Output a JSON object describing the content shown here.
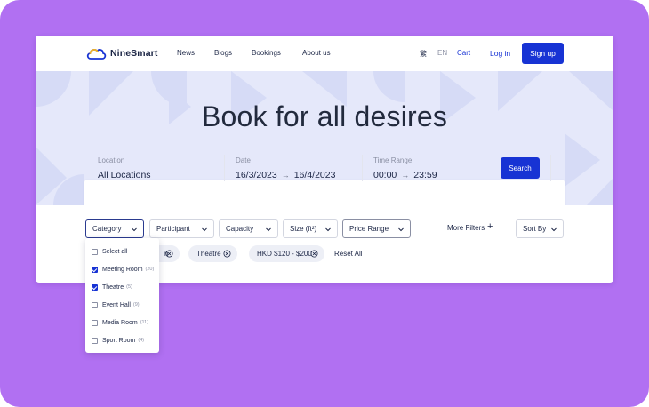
{
  "brand": {
    "name": "NineSmart"
  },
  "nav": {
    "items": [
      "News",
      "Blogs",
      "Bookings",
      "About us"
    ]
  },
  "header": {
    "lang_tc": "繁",
    "lang_en": "EN",
    "cart": "Cart",
    "login": "Log in",
    "signup": "Sign up"
  },
  "hero": {
    "title": "Book for all desires"
  },
  "search": {
    "location_label": "Location",
    "location_value": "All Locations",
    "date_label": "Date",
    "date_start": "16/3/2023",
    "date_end": "16/4/2023",
    "time_label": "Time Range",
    "time_start": "00:00",
    "time_end": "23:59",
    "arrow": "→",
    "button": "Search"
  },
  "filters": {
    "category": "Category",
    "participant": "Participant",
    "capacity": "Capacity",
    "size": "Size (ft²)",
    "price": "Price Range",
    "more": "More Filters",
    "more_icon": "+",
    "sort": "Sort By"
  },
  "chips": {
    "first_partial": "n",
    "theatre": "Theatre",
    "price": "HKD $120 - $200",
    "reset": "Reset All"
  },
  "dropdown": {
    "items": [
      {
        "label": "Select all",
        "count": "",
        "checked": false
      },
      {
        "label": "Meeting Room",
        "count": "(20)",
        "checked": true
      },
      {
        "label": "Theatre",
        "count": "(5)",
        "checked": true
      },
      {
        "label": "Event Hall",
        "count": "(9)",
        "checked": false
      },
      {
        "label": "Media Room",
        "count": "(11)",
        "checked": false
      },
      {
        "label": "Sport Room",
        "count": "(4)",
        "checked": false
      }
    ]
  },
  "colors": {
    "accent": "#1733d4",
    "background": "#b170f2",
    "hero": "#e5e8fa",
    "text": "#1b2545"
  }
}
